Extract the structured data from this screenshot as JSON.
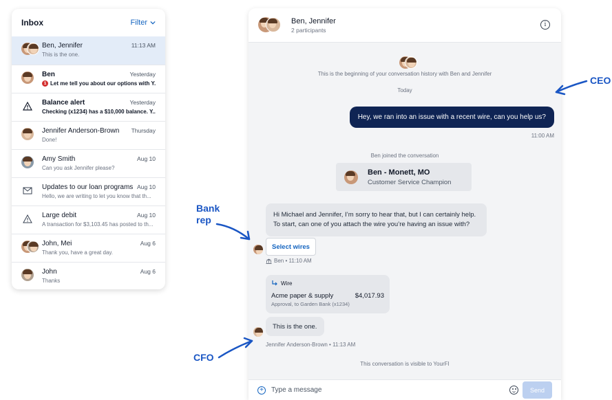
{
  "colors": {
    "accent": "#1565c0",
    "outgoing_bubble": "#0f2454",
    "annotation": "#1a56c4",
    "selected_row": "#e3ecf8",
    "unread_badge": "#d32f2f"
  },
  "inbox": {
    "title": "Inbox",
    "filter_label": "Filter",
    "items": [
      {
        "name": "Ben, Jennifer",
        "time": "11:13 AM",
        "preview": "This is the one.",
        "avatar": "pair-avatar"
      },
      {
        "name": "Ben",
        "time": "Yesterday",
        "preview": "Let me tell you about our options with Y...",
        "badge": "1",
        "avatar": "person-avatar"
      },
      {
        "name": "Balance alert",
        "time": "Yesterday",
        "preview": "Checking (x1234) has a $10,000 balance. Y...",
        "icon": "warning-icon"
      },
      {
        "name": "Jennifer Anderson-Brown",
        "time": "Thursday",
        "preview": "Done!",
        "avatar": "person-avatar"
      },
      {
        "name": "Amy Smith",
        "time": "Aug 10",
        "preview": "Can you ask Jennifer please?",
        "avatar": "person-avatar"
      },
      {
        "name": "Updates to our loan programs",
        "time": "Aug 10",
        "preview": "Hello, we are writing to let you know that th...",
        "icon": "mail-icon"
      },
      {
        "name": "Large debit",
        "time": "Aug 10",
        "preview": "A transaction for $3,103.45 has posted to th...",
        "icon": "warning-icon"
      },
      {
        "name": "John, Mei",
        "time": "Aug 6",
        "preview": "Thank you, have a great day.",
        "avatar": "pair-avatar"
      },
      {
        "name": "John",
        "time": "Aug 6",
        "preview": "Thanks",
        "avatar": "person-avatar"
      }
    ]
  },
  "chat": {
    "title": "Ben, Jennifer",
    "subtitle": "2 participants",
    "beginning_note": "This is the beginning of your conversation history with Ben and Jennifer",
    "day_label": "Today",
    "outgoing_message": "Hey, we ran into an issue with a recent wire, can you help us?",
    "outgoing_time": "11:00 AM",
    "joined_note": "Ben joined the conversation",
    "agent_card": {
      "name": "Ben - Monett, MO",
      "role": "Customer Service Champion"
    },
    "bank_message_line1": "Hi Michael and Jennifer, I’m sorry to hear that, but I can certainly help.",
    "bank_message_line2": "To start, can one of you attach the wire you’re having an issue with?",
    "select_wires_label": "Select wires",
    "bank_meta": "Ben • 11:10 AM",
    "wire": {
      "header": "Wire",
      "payee": "Acme paper & supply",
      "amount": "$4,017.93",
      "detail": "Approval, to Garden Bank (x1234)"
    },
    "cfo_message": "This is the one.",
    "cfo_meta": "Jennifer Anderson-Brown • 11:13 AM",
    "visibility_note": "This conversation is visible to YourFI",
    "composer_placeholder": "Type a message",
    "send_label": "Send"
  },
  "annotations": {
    "ceo": "CEO",
    "bank_rep_line1": "Bank",
    "bank_rep_line2": "rep",
    "cfo": "CFO"
  }
}
